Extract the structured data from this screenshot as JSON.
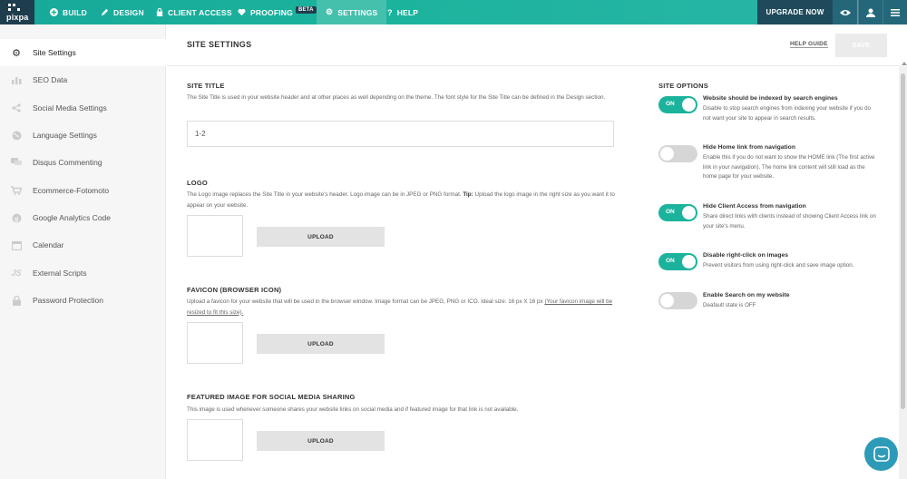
{
  "topbar": {
    "logo_text": "pixpa",
    "nav": [
      {
        "label": "BUILD",
        "icon": "plus-circle-icon"
      },
      {
        "label": "DESIGN",
        "icon": "pencil-icon"
      },
      {
        "label": "CLIENT ACCESS",
        "icon": "lock-icon"
      },
      {
        "label": "PROOFING",
        "icon": "heart-icon",
        "badge": "BETA"
      },
      {
        "label": "SETTINGS",
        "icon": "gear-icon",
        "active": true
      },
      {
        "label": "HELP",
        "icon": "question-icon"
      }
    ],
    "upgrade_label": "UPGRADE NOW",
    "colors": {
      "accent": "#1bb39c",
      "dark": "#1e4a5c"
    }
  },
  "sidebar": {
    "items": [
      {
        "label": "Site Settings",
        "icon": "gear-icon",
        "active": true
      },
      {
        "label": "SEO Data",
        "icon": "bar-chart-icon"
      },
      {
        "label": "Social Media Settings",
        "icon": "share-icon"
      },
      {
        "label": "Language Settings",
        "icon": "globe-icon"
      },
      {
        "label": "Disqus Commenting",
        "icon": "comments-icon"
      },
      {
        "label": "Ecommerce-Fotomoto",
        "icon": "cart-icon"
      },
      {
        "label": "Google Analytics Code",
        "icon": "google-icon"
      },
      {
        "label": "Calendar",
        "icon": "calendar-icon"
      },
      {
        "label": "External Scripts",
        "icon": "js-icon"
      },
      {
        "label": "Password Protection",
        "icon": "padlock-icon"
      }
    ]
  },
  "header": {
    "title": "SITE SETTINGS",
    "help_guide": "HELP GUIDE",
    "save_label": "SAVE"
  },
  "site_title": {
    "heading": "SITE TITLE",
    "description": "The Site Title is used in your website header and at other places as well depending on the theme. The font style for the Site Title can be defined in the Design section.",
    "value": "1-2"
  },
  "logo": {
    "heading": "LOGO",
    "description_pre": "The Logo image replaces the Site Title in your website's header. Logo image can be in JPEG or PNG format. ",
    "tip_label": "Tip:",
    "description_post": " Upload the logo image in the right size as you want it to appear on your website.",
    "upload_label": "UPLOAD"
  },
  "favicon": {
    "heading": "FAVICON (BROWSER ICON)",
    "description_pre": "Upload a favicon for your website that will be used in the browser window. Image format can be JPEG, PNG or ICO. Ideal size: 16 px X 16 px ",
    "description_underlined": "(Your favicon image will be resized to fit this size).",
    "upload_label": "UPLOAD"
  },
  "featured": {
    "heading": "FEATURED IMAGE FOR SOCIAL MEDIA SHARING",
    "description": "This image is used whenever someone shares your website links on social media and if featured image for that link is not available.",
    "upload_label": "UPLOAD"
  },
  "site_options": {
    "heading": "SITE OPTIONS",
    "options": [
      {
        "title": "Website should be indexed by search engines",
        "description": "Disable to stop search engines from indexing your website if you do not want your site to appear in search results.",
        "state": "ON",
        "on": true
      },
      {
        "title": "Hide Home link from navigation",
        "description": "Enable this if you do not want to show the HOME link (The first active link in your navigation). The home link content will still load as the home page for your website.",
        "state": "",
        "on": false
      },
      {
        "title": "Hide Client Access from navigation",
        "description": "Share direct links with clients instead of showing Client Access link on your site's menu.",
        "state": "ON",
        "on": true
      },
      {
        "title": "Disable right-click on images",
        "description": "Prevent visitors from using right-click and save image option.",
        "state": "ON",
        "on": true
      },
      {
        "title": "Enable Search on my website",
        "description": "Deafault state is OFF",
        "state": "",
        "on": false
      }
    ]
  }
}
